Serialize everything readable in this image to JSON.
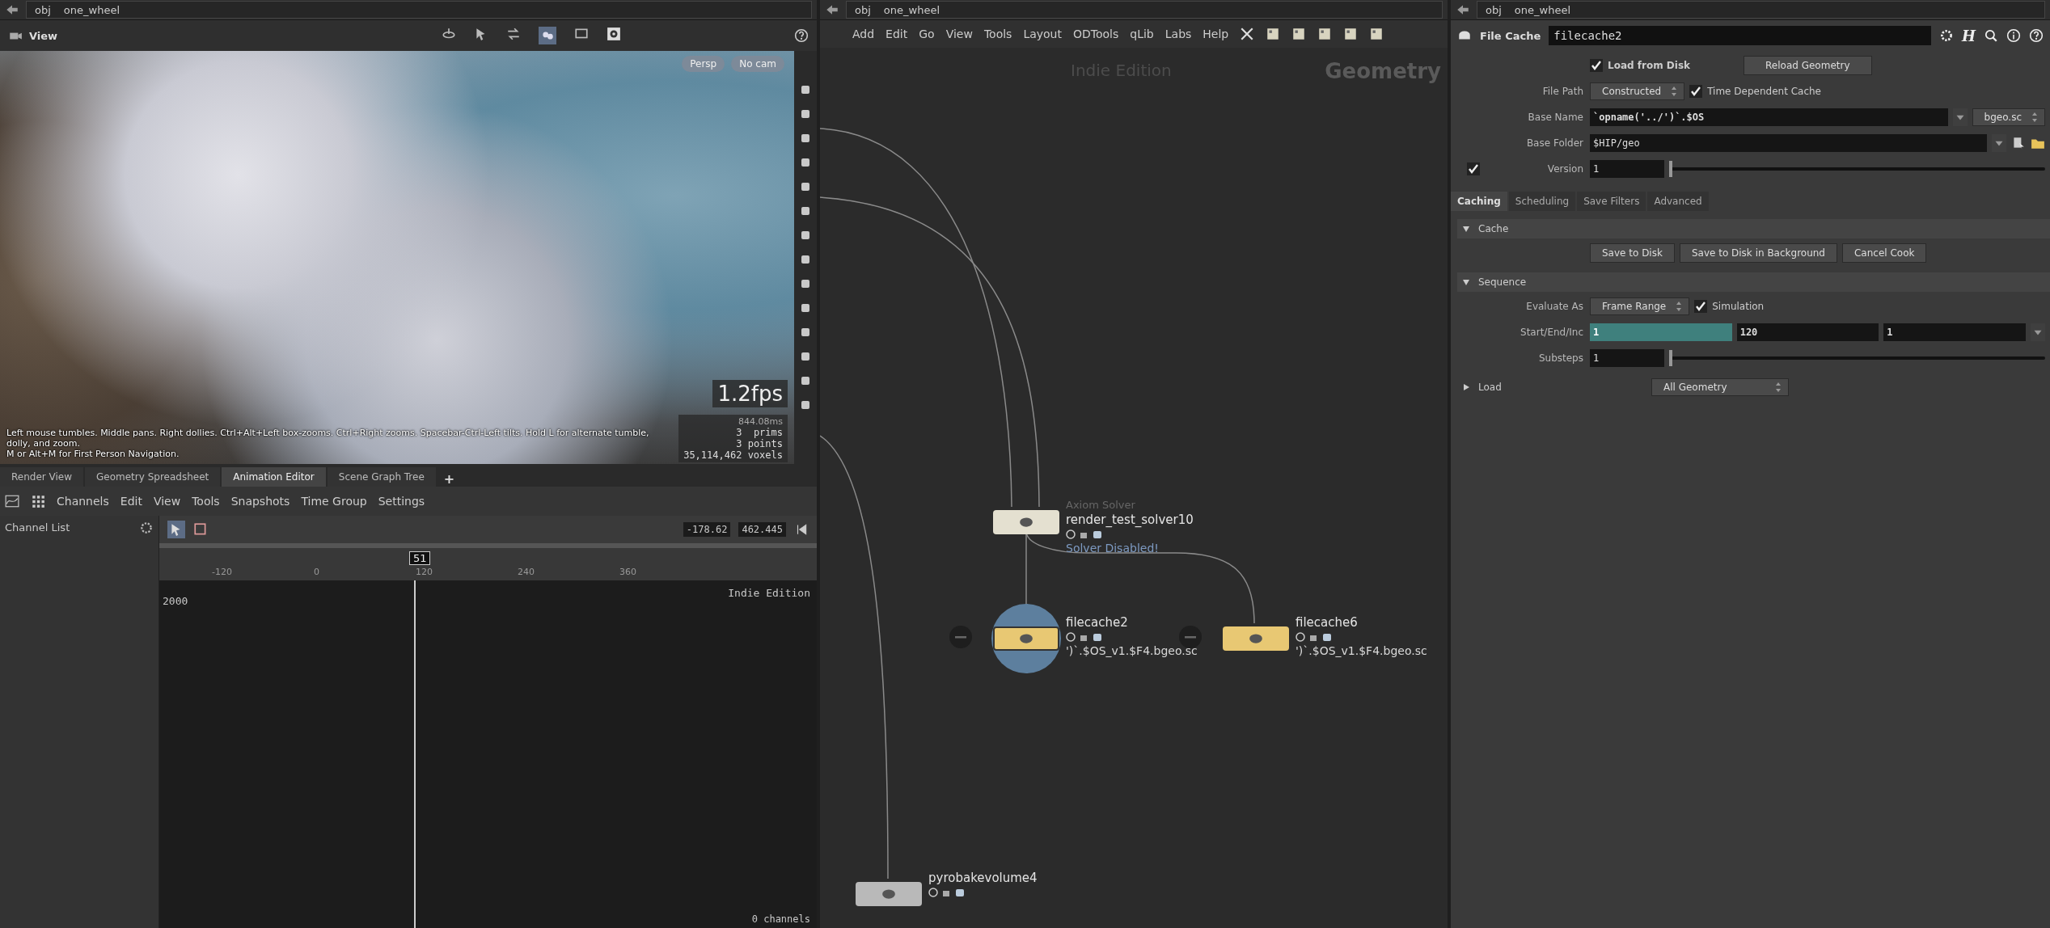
{
  "viewer": {
    "path": [
      "obj",
      "one_wheel"
    ],
    "title": "View",
    "camera_menus": [
      "Persp",
      "No cam"
    ],
    "fps": "1.2fps",
    "cook_time": "844.08ms",
    "stats": [
      "3  prims",
      "3 points",
      "35,114,462 voxels"
    ],
    "help_lines": [
      "Left mouse tumbles. Middle pans. Right dollies. Ctrl+Alt+Left box-zooms. Ctrl+Right zooms. Spacebar-Ctrl-Left tilts. Hold L for alternate tumble, dolly, and zoom.",
      "M or Alt+M for First Person Navigation."
    ]
  },
  "bottom_panel": {
    "tabs": [
      {
        "label": "Render View",
        "selected": false
      },
      {
        "label": "Geometry Spreadsheet",
        "selected": false
      },
      {
        "label": "Animation Editor",
        "selected": true
      },
      {
        "label": "Scene Graph Tree",
        "selected": false
      }
    ],
    "add_tab": "+",
    "menu": [
      "Channels",
      "Edit",
      "View",
      "Tools",
      "Snapshots",
      "Time Group",
      "Settings"
    ],
    "channel_list": "Channel List",
    "range": [
      "-178.62",
      "462.445"
    ],
    "ruler_ticks": [
      "-120",
      "0",
      "120",
      "240",
      "360"
    ],
    "current_frame": "51",
    "value_label": "2000",
    "edition": "Indie Edition",
    "channel_count": "0 channels"
  },
  "network": {
    "path": [
      "obj",
      "one_wheel"
    ],
    "menu": [
      "Add",
      "Edit",
      "Go",
      "View",
      "Tools",
      "Layout",
      "ODTools",
      "qLib",
      "Labs",
      "Help"
    ],
    "edition": "Indie Edition",
    "context": "Geometry",
    "nodes": [
      {
        "kind": "solver",
        "type": "Axiom Solver",
        "name": "render_test_solver10",
        "message": "Solver Disabled!",
        "selected": false
      },
      {
        "kind": "cache",
        "name": "filecache2",
        "file": "')`.$OS_v1.$F4.bgeo.sc",
        "selected": true
      },
      {
        "kind": "cache",
        "name": "filecache6",
        "file": "')`.$OS_v1.$F4.bgeo.sc",
        "selected": false
      },
      {
        "kind": "bake",
        "name": "pyrobakevolume4",
        "selected": false
      }
    ]
  },
  "parameters": {
    "path": [
      "obj",
      "one_wheel"
    ],
    "node_type": "File Cache",
    "node_name": "filecache2",
    "header_glyph": "H",
    "top_rows": [
      {
        "kind": "check",
        "label": "Load from Disk",
        "checked": true,
        "button": "Reload Geometry"
      },
      {
        "kind": "menu",
        "label": "File Path",
        "value": "Constructed",
        "toggle": {
          "label": "Time Dependent Cache",
          "checked": true
        }
      },
      {
        "kind": "text",
        "label": "Base Name",
        "value": "`opname('../')`.$OS",
        "extension": "bgeo.sc"
      },
      {
        "kind": "path",
        "label": "Base Folder",
        "value": "$HIP/geo"
      },
      {
        "kind": "slider",
        "label": "Version",
        "value": "1",
        "level": 0,
        "checked": true
      }
    ],
    "tabs": [
      {
        "label": "Caching",
        "selected": true
      },
      {
        "label": "Scheduling",
        "selected": false
      },
      {
        "label": "Save Filters",
        "selected": false
      },
      {
        "label": "Advanced",
        "selected": false
      }
    ],
    "tab_rows": [
      {
        "kind": "section",
        "title": "Cache",
        "expanded": true
      },
      {
        "kind": "buttons",
        "buttons": [
          "Save to Disk",
          "Save to Disk in Background",
          "Cancel Cook"
        ]
      },
      {
        "kind": "section",
        "title": "Sequence",
        "expanded": true
      },
      {
        "kind": "menu",
        "label": "Evaluate As",
        "value": "Frame Range",
        "toggle": {
          "label": "Simulation",
          "checked": true
        }
      },
      {
        "kind": "triple",
        "label": "Start/End/Inc",
        "fields": [
          {
            "value": "1",
            "highlighted": true
          },
          {
            "value": "120",
            "highlighted": false
          },
          {
            "value": "1",
            "highlighted": false
          }
        ]
      },
      {
        "kind": "slider",
        "label": "Substeps",
        "value": "1",
        "level": 0
      },
      {
        "kind": "section",
        "title": "Load",
        "expanded": false,
        "value": "All Geometry"
      }
    ]
  }
}
